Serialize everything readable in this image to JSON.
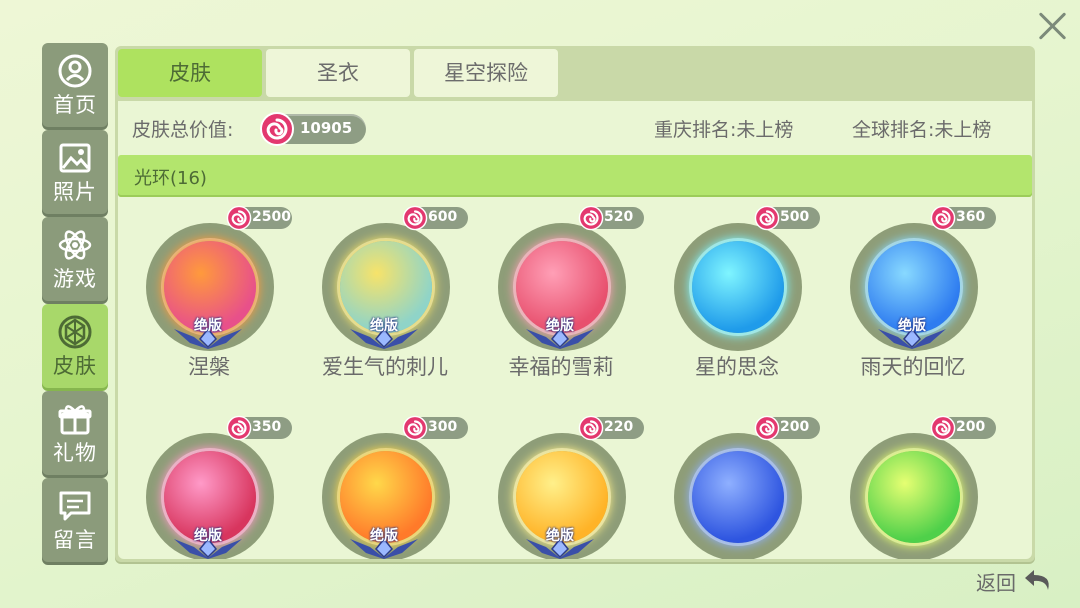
{
  "nav": [
    {
      "label": "首页",
      "icon": "profile-icon"
    },
    {
      "label": "照片",
      "icon": "photo-icon"
    },
    {
      "label": "游戏",
      "icon": "atom-icon"
    },
    {
      "label": "皮肤",
      "icon": "skin-icon",
      "active": true
    },
    {
      "label": "礼物",
      "icon": "gift-icon"
    },
    {
      "label": "留言",
      "icon": "message-icon"
    }
  ],
  "tabs": [
    {
      "label": "皮肤",
      "active": true
    },
    {
      "label": "圣衣"
    },
    {
      "label": "星空探险"
    }
  ],
  "summary": {
    "value_label": "皮肤总价值:",
    "value": "10905",
    "city_rank": "重庆排名:未上榜",
    "global_rank": "全球排名:未上榜"
  },
  "section": {
    "title": "光环(16)"
  },
  "skins": [
    {
      "name": "涅槃",
      "price": "2500",
      "badge": "绝版",
      "colors": [
        "#ff9a3c",
        "#e8508a"
      ]
    },
    {
      "name": "爱生气的刺儿",
      "price": "600",
      "badge": "绝版",
      "colors": [
        "#f7e36a",
        "#8fd4c8"
      ]
    },
    {
      "name": "幸福的雪莉",
      "price": "520",
      "badge": "绝版",
      "colors": [
        "#ff9fb6",
        "#e8506e"
      ]
    },
    {
      "name": "星的思念",
      "price": "500",
      "badge": "",
      "colors": [
        "#7ff5ff",
        "#1f9bea"
      ]
    },
    {
      "name": "雨天的回忆",
      "price": "360",
      "badge": "绝版",
      "colors": [
        "#88d9ff",
        "#2e7cf0"
      ]
    },
    {
      "name": "",
      "price": "350",
      "badge": "绝版",
      "colors": [
        "#ff9ac8",
        "#d8355e"
      ]
    },
    {
      "name": "",
      "price": "300",
      "badge": "绝版",
      "colors": [
        "#ffd84a",
        "#ff7a2a"
      ]
    },
    {
      "name": "",
      "price": "220",
      "badge": "绝版",
      "colors": [
        "#fff08a",
        "#ffb327"
      ]
    },
    {
      "name": "",
      "price": "200",
      "badge": "",
      "colors": [
        "#8fb0ff",
        "#2e55e0"
      ]
    },
    {
      "name": "",
      "price": "200",
      "badge": "",
      "colors": [
        "#e6ff72",
        "#4fd04a"
      ]
    }
  ],
  "footer": {
    "back_label": "返回"
  },
  "colors": {
    "accent": "#aee25f",
    "panel": "#c9d9a8",
    "nav": "#8b9b7b",
    "coin": "#e3386f"
  }
}
